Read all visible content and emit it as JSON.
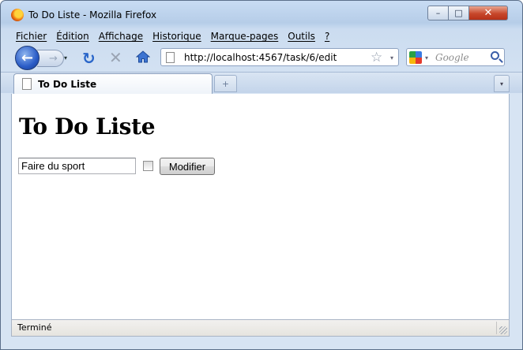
{
  "window": {
    "title": "To Do Liste - Mozilla Firefox",
    "controls": {
      "minimize": "–",
      "maximize": "□",
      "close": "✕"
    }
  },
  "menubar": {
    "items": [
      "Fichier",
      "Édition",
      "Affichage",
      "Historique",
      "Marque-pages",
      "Outils",
      "?"
    ]
  },
  "navbar": {
    "back": "←",
    "forward": "→",
    "reload": "↻",
    "stop": "✕",
    "url": "http://localhost:4567/task/6/edit",
    "search_placeholder": "Google",
    "dropdown": "▾"
  },
  "tabs": {
    "items": [
      {
        "label": "To Do Liste",
        "active": true
      }
    ],
    "new_tab": "+",
    "all_tabs": "▾"
  },
  "page": {
    "heading": "To Do Liste",
    "task_value": "Faire du sport",
    "done_checked": false,
    "modify_label": "Modifier"
  },
  "status": {
    "text": "Terminé"
  },
  "colors": {
    "chrome_blue": "#c8dcf3",
    "accent_blue": "#2a5cc7",
    "close_red": "#c7472b"
  },
  "icons": [
    "firefox-icon",
    "back-arrow-icon",
    "forward-arrow-icon",
    "reload-icon",
    "stop-icon",
    "home-icon",
    "page-icon",
    "star-icon",
    "google-icon",
    "magnifier-icon"
  ]
}
